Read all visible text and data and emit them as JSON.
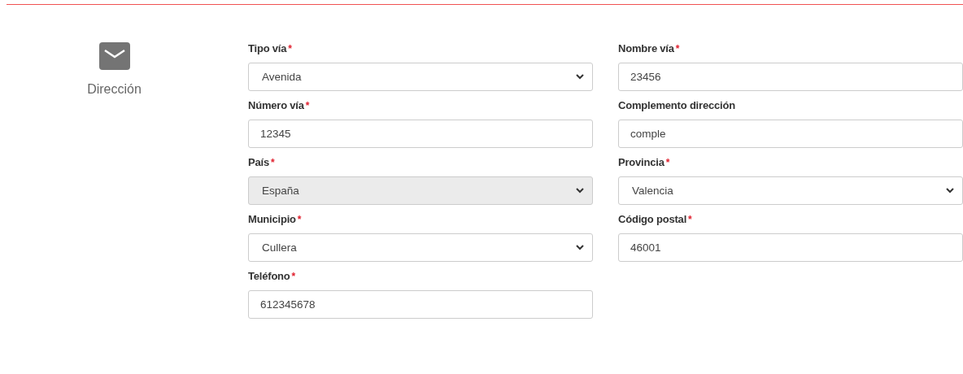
{
  "section": {
    "title": "Dirección"
  },
  "fields": [
    {
      "label": "Tipo vía",
      "required_mark": "*",
      "kind": "select",
      "value": "Avenida",
      "disabled": false
    },
    {
      "label": "Nombre vía",
      "required_mark": "*",
      "kind": "text",
      "value": "23456",
      "disabled": false
    },
    {
      "label": "Número vía",
      "required_mark": "*",
      "kind": "text",
      "value": "12345",
      "disabled": false
    },
    {
      "label": "Complemento dirección",
      "kind": "text",
      "value": "comple",
      "disabled": false
    },
    {
      "label": "País",
      "required_mark": "*",
      "kind": "select",
      "value": "España",
      "disabled": true
    },
    {
      "label": "Provincia",
      "required_mark": "*",
      "kind": "select",
      "value": "Valencia",
      "disabled": false
    },
    {
      "label": "Municipio",
      "required_mark": "*",
      "kind": "select",
      "value": "Cullera",
      "disabled": false
    },
    {
      "label": "Código postal",
      "required_mark": "*",
      "kind": "text",
      "value": "46001",
      "disabled": false
    },
    {
      "label": "Teléfono",
      "required_mark": "*",
      "kind": "text",
      "value": "612345678",
      "disabled": false
    }
  ]
}
